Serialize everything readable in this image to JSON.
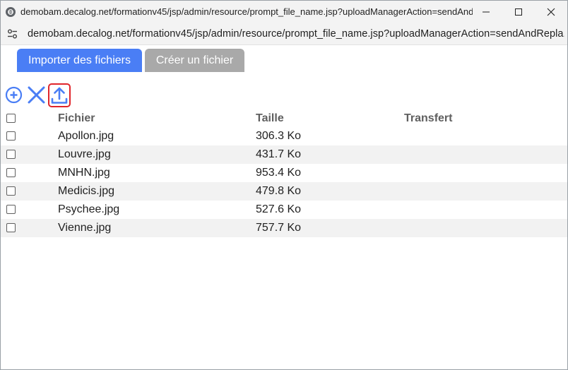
{
  "window": {
    "title": "demobam.decalog.net/formationv45/jsp/admin/resource/prompt_file_name.jsp?uploadManagerAction=sendAndRepla...",
    "url": "demobam.decalog.net/formationv45/jsp/admin/resource/prompt_file_name.jsp?uploadManagerAction=sendAndRepla...",
    "controls": [
      "minimize-icon",
      "maximize-icon",
      "close-icon"
    ]
  },
  "tabs": [
    {
      "label": "Importer des fichiers",
      "active": true
    },
    {
      "label": "Créer un fichier",
      "active": false
    }
  ],
  "toolbar": {
    "icons": [
      "add-circle-icon",
      "delete-x-icon",
      "upload-icon"
    ],
    "accent": "#4a7ef5",
    "highlight": "#e0252b"
  },
  "table": {
    "headers": {
      "file": "Fichier",
      "size": "Taille",
      "transfer": "Transfert"
    },
    "rows": [
      {
        "file": "Apollon.jpg",
        "size": "306.3 Ko",
        "transfer": ""
      },
      {
        "file": "Louvre.jpg",
        "size": "431.7 Ko",
        "transfer": ""
      },
      {
        "file": "MNHN.jpg",
        "size": "953.4 Ko",
        "transfer": ""
      },
      {
        "file": "Medicis.jpg",
        "size": "479.8 Ko",
        "transfer": ""
      },
      {
        "file": "Psychee.jpg",
        "size": "527.6 Ko",
        "transfer": ""
      },
      {
        "file": "Vienne.jpg",
        "size": "757.7 Ko",
        "transfer": ""
      }
    ]
  }
}
